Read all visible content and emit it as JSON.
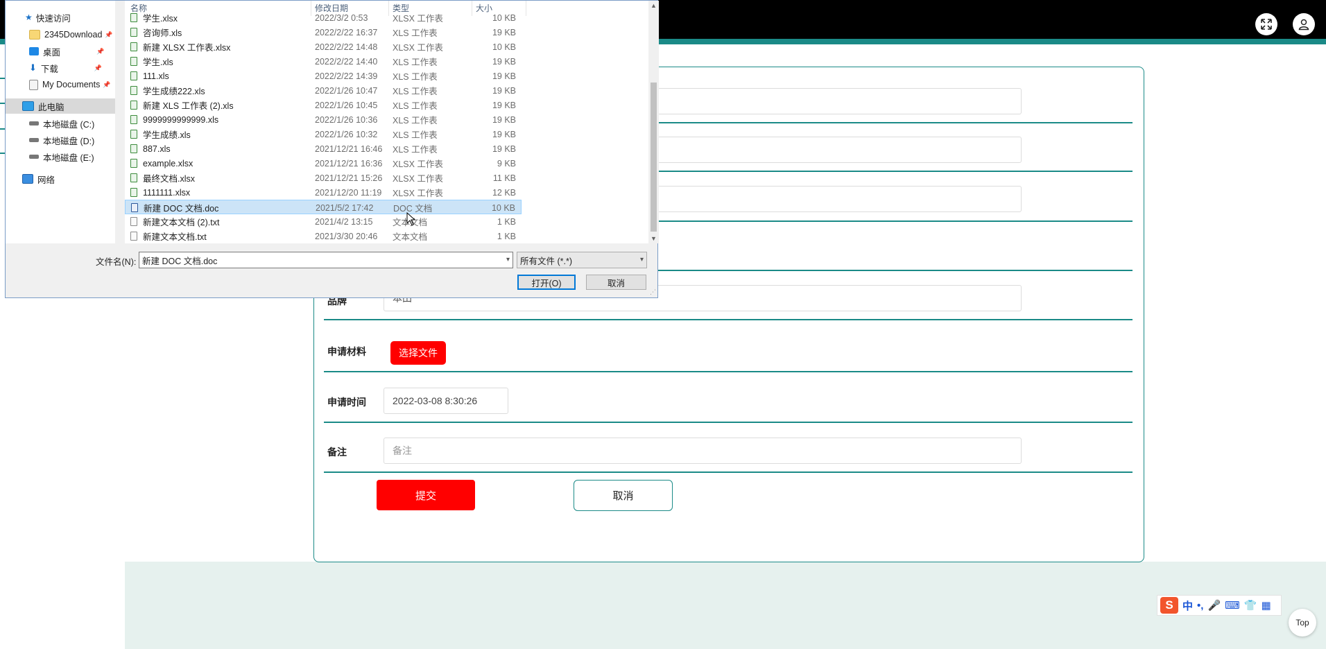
{
  "page": {
    "submit_label": "提交",
    "cancel_label": "取消",
    "top_label": "Top",
    "fields": {
      "partial_value": "本田",
      "partial_label": "品牌",
      "material_label": "申请材料",
      "choose_file_label": "选择文件",
      "time_label": "申请时间",
      "time_value": "2022-03-08 8:30:26",
      "remark_label": "备注",
      "remark_placeholder": "备注"
    },
    "ime": {
      "logo": "S",
      "mode": "中",
      "punct": "•,",
      "mic": "🎤",
      "keyboard": "⌨",
      "skin": "👕",
      "apps": "▦"
    },
    "accent_color": "#1a8a87",
    "button_color": "#ff0000"
  },
  "dialog": {
    "columns": {
      "name": "名称",
      "modified": "修改日期",
      "type": "类型",
      "size": "大小"
    },
    "nav": [
      {
        "label": "快速访问",
        "icon": "star-icon"
      },
      {
        "label": "2345Download",
        "icon": "folder-icon",
        "pinned": "📌"
      },
      {
        "label": "桌面",
        "icon": "desktop-icon",
        "pinned": "📌"
      },
      {
        "label": "下载",
        "icon": "download-icon",
        "pinned": "📌"
      },
      {
        "label": "My Documents",
        "icon": "documents-icon",
        "pinned": "📌"
      },
      {
        "label": "此电脑",
        "icon": "computer-icon"
      },
      {
        "label": "本地磁盘 (C:)",
        "icon": "drive-icon"
      },
      {
        "label": "本地磁盘 (D:)",
        "icon": "drive-icon"
      },
      {
        "label": "本地磁盘 (E:)",
        "icon": "drive-icon"
      },
      {
        "label": "网络",
        "icon": "network-icon"
      }
    ],
    "files": [
      {
        "name": "学生.xlsx",
        "date": "2022/3/2 0:53",
        "type": "XLSX 工作表",
        "size": "10 KB",
        "kind": "xls"
      },
      {
        "name": "咨询师.xls",
        "date": "2022/2/22 16:37",
        "type": "XLS 工作表",
        "size": "19 KB",
        "kind": "xls"
      },
      {
        "name": "新建 XLSX 工作表.xlsx",
        "date": "2022/2/22 14:48",
        "type": "XLSX 工作表",
        "size": "10 KB",
        "kind": "xls"
      },
      {
        "name": "学生.xls",
        "date": "2022/2/22 14:40",
        "type": "XLS 工作表",
        "size": "19 KB",
        "kind": "xls"
      },
      {
        "name": "111.xls",
        "date": "2022/2/22 14:39",
        "type": "XLS 工作表",
        "size": "19 KB",
        "kind": "xls"
      },
      {
        "name": "学生成绩222.xls",
        "date": "2022/1/26 10:47",
        "type": "XLS 工作表",
        "size": "19 KB",
        "kind": "xls"
      },
      {
        "name": "新建 XLS 工作表 (2).xls",
        "date": "2022/1/26 10:45",
        "type": "XLS 工作表",
        "size": "19 KB",
        "kind": "xls"
      },
      {
        "name": "9999999999999.xls",
        "date": "2022/1/26 10:36",
        "type": "XLS 工作表",
        "size": "19 KB",
        "kind": "xls"
      },
      {
        "name": "学生成绩.xls",
        "date": "2022/1/26 10:32",
        "type": "XLS 工作表",
        "size": "19 KB",
        "kind": "xls"
      },
      {
        "name": "887.xls",
        "date": "2021/12/21 16:46",
        "type": "XLS 工作表",
        "size": "19 KB",
        "kind": "xls"
      },
      {
        "name": "example.xlsx",
        "date": "2021/12/21 16:36",
        "type": "XLSX 工作表",
        "size": "9 KB",
        "kind": "xls"
      },
      {
        "name": "最终文档.xlsx",
        "date": "2021/12/21 15:26",
        "type": "XLSX 工作表",
        "size": "11 KB",
        "kind": "xls"
      },
      {
        "name": "1111111.xlsx",
        "date": "2021/12/20 11:19",
        "type": "XLSX 工作表",
        "size": "12 KB",
        "kind": "xls"
      },
      {
        "name": "新建 DOC 文档.doc",
        "date": "2021/5/2 17:42",
        "type": "DOC 文档",
        "size": "10 KB",
        "kind": "doc",
        "selected": true
      },
      {
        "name": "新建文本文档 (2).txt",
        "date": "2021/4/2 13:15",
        "type": "文本文档",
        "size": "1 KB",
        "kind": "txt"
      },
      {
        "name": "新建文本文档.txt",
        "date": "2021/3/30 20:46",
        "type": "文本文档",
        "size": "1 KB",
        "kind": "txt"
      }
    ],
    "filename_label": "文件名(N):",
    "filename_value": "新建 DOC 文档.doc",
    "filter_value": "所有文件 (*.*)",
    "open_label": "打开(O)",
    "cancel_label": "取消"
  }
}
